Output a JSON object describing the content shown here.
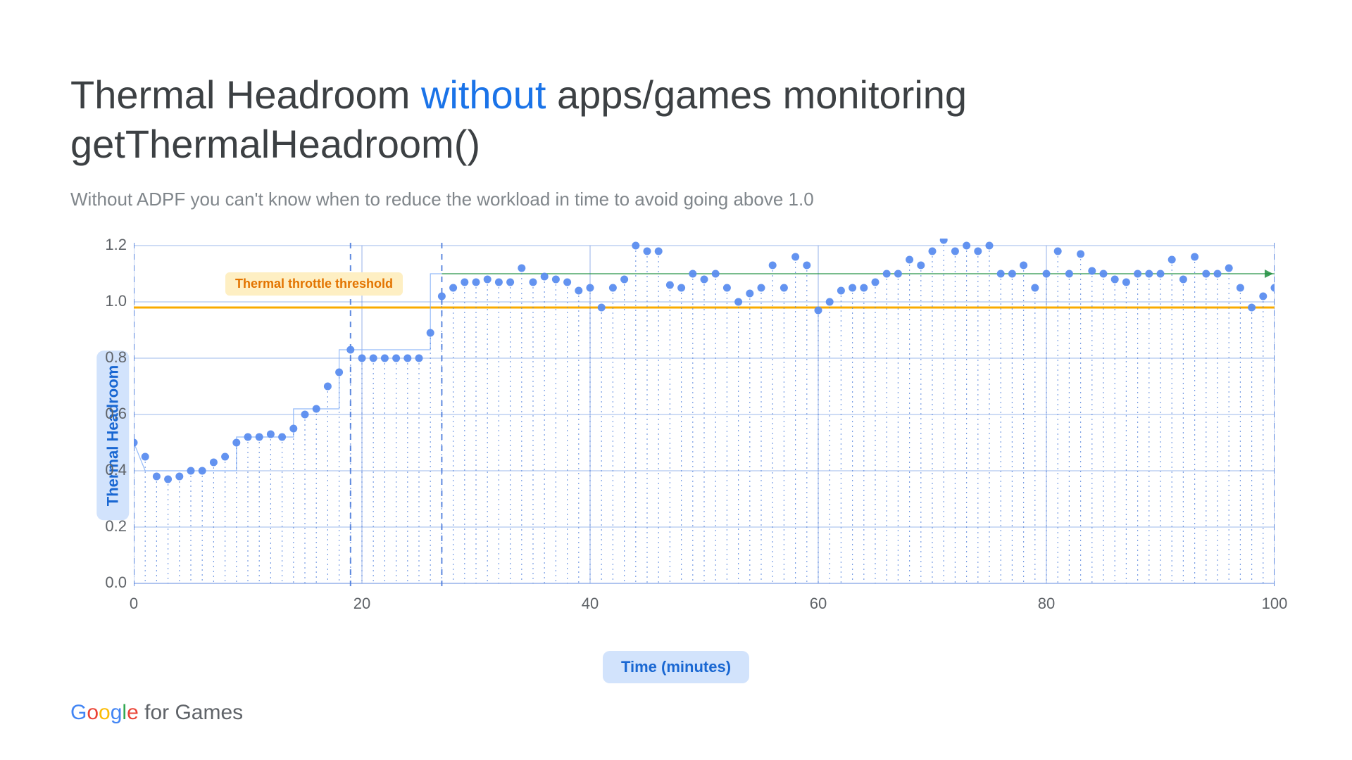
{
  "title_prefix": "Thermal Headroom ",
  "title_highlight": "without",
  "title_suffix": " apps/games monitoring getThermalHeadroom()",
  "subtitle": "Without ADPF you can't know when to reduce the workload in time to avoid going above 1.0",
  "chart_data": {
    "type": "scatter",
    "xlabel": "Time (minutes)",
    "ylabel": "Thermal Headroom",
    "xlim": [
      0,
      100
    ],
    "ylim": [
      0.0,
      1.2
    ],
    "y_ticks": [
      0.0,
      0.2,
      0.4,
      0.6,
      0.8,
      1.0,
      1.2
    ],
    "x_ticks": [
      0,
      20,
      40,
      60,
      80,
      100
    ],
    "threshold_label": "Thermal throttle threshold",
    "threshold_y": 0.98,
    "reference_line_y": 1.1,
    "vertical_dashed_x": [
      0,
      19,
      27,
      100
    ],
    "x": [
      0,
      1,
      2,
      3,
      4,
      5,
      6,
      7,
      8,
      9,
      10,
      11,
      12,
      13,
      14,
      15,
      16,
      17,
      18,
      19,
      20,
      21,
      22,
      23,
      24,
      25,
      26,
      27,
      28,
      29,
      30,
      31,
      32,
      33,
      34,
      35,
      36,
      37,
      38,
      39,
      40,
      41,
      42,
      43,
      44,
      45,
      46,
      47,
      48,
      49,
      50,
      51,
      52,
      53,
      54,
      55,
      56,
      57,
      58,
      59,
      60,
      61,
      62,
      63,
      64,
      65,
      66,
      67,
      68,
      69,
      70,
      71,
      72,
      73,
      74,
      75,
      76,
      77,
      78,
      79,
      80,
      81,
      82,
      83,
      84,
      85,
      86,
      87,
      88,
      89,
      90,
      91,
      92,
      93,
      94,
      95,
      96,
      97,
      98,
      99,
      100
    ],
    "values": [
      0.5,
      0.45,
      0.38,
      0.37,
      0.38,
      0.4,
      0.4,
      0.43,
      0.45,
      0.5,
      0.52,
      0.52,
      0.53,
      0.52,
      0.55,
      0.6,
      0.62,
      0.7,
      0.75,
      0.83,
      0.8,
      0.8,
      0.8,
      0.8,
      0.8,
      0.8,
      0.89,
      1.02,
      1.05,
      1.07,
      1.07,
      1.08,
      1.07,
      1.07,
      1.12,
      1.07,
      1.09,
      1.08,
      1.07,
      1.04,
      1.05,
      0.98,
      1.05,
      1.08,
      1.2,
      1.18,
      1.18,
      1.06,
      1.05,
      1.1,
      1.08,
      1.1,
      1.05,
      1.0,
      1.03,
      1.05,
      1.13,
      1.05,
      1.16,
      1.13,
      0.97,
      1.0,
      1.04,
      1.05,
      1.05,
      1.07,
      1.1,
      1.1,
      1.15,
      1.13,
      1.18,
      1.22,
      1.18,
      1.2,
      1.18,
      1.2,
      1.1,
      1.1,
      1.13,
      1.05,
      1.1,
      1.18,
      1.1,
      1.17,
      1.11,
      1.1,
      1.08,
      1.07,
      1.1,
      1.1,
      1.1,
      1.15,
      1.08,
      1.16,
      1.1,
      1.1,
      1.12,
      1.05,
      0.98,
      1.02,
      1.05
    ]
  },
  "footer_brand_letters": [
    "G",
    "o",
    "o",
    "g",
    "l",
    "e"
  ],
  "footer_suffix": " for Games"
}
